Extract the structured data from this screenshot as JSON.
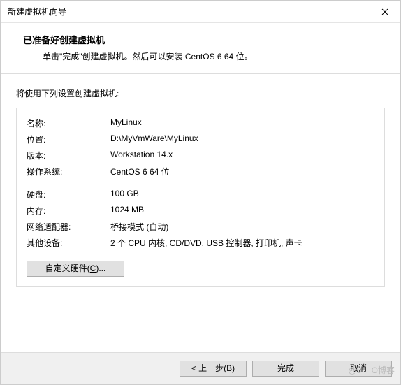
{
  "window": {
    "title": "新建虚拟机向导"
  },
  "header": {
    "heading": "已准备好创建虚拟机",
    "subheading": "单击\"完成\"创建虚拟机。然后可以安装 CentOS 6 64 位。"
  },
  "content": {
    "intro": "将使用下列设置创建虚拟机:"
  },
  "settings": {
    "rows": [
      {
        "label": "名称:",
        "value": "MyLinux"
      },
      {
        "label": "位置:",
        "value": "D:\\MyVmWare\\MyLinux"
      },
      {
        "label": "版本:",
        "value": "Workstation 14.x"
      },
      {
        "label": "操作系统:",
        "value": "CentOS 6 64 位"
      }
    ],
    "rows2": [
      {
        "label": "硬盘:",
        "value": "100 GB"
      },
      {
        "label": "内存:",
        "value": "1024 MB"
      },
      {
        "label": "网络适配器:",
        "value": "桥接模式 (自动)"
      },
      {
        "label": "其他设备:",
        "value": "2 个 CPU 内核, CD/DVD, USB 控制器, 打印机, 声卡"
      }
    ]
  },
  "buttons": {
    "customize_prefix": "自定义硬件(",
    "customize_hotkey": "C",
    "customize_suffix": ")...",
    "back_prefix": "< 上一步(",
    "back_hotkey": "B",
    "back_suffix": ")",
    "finish": "完成",
    "cancel": "取消"
  },
  "watermark": "@5 ㅤO博客"
}
